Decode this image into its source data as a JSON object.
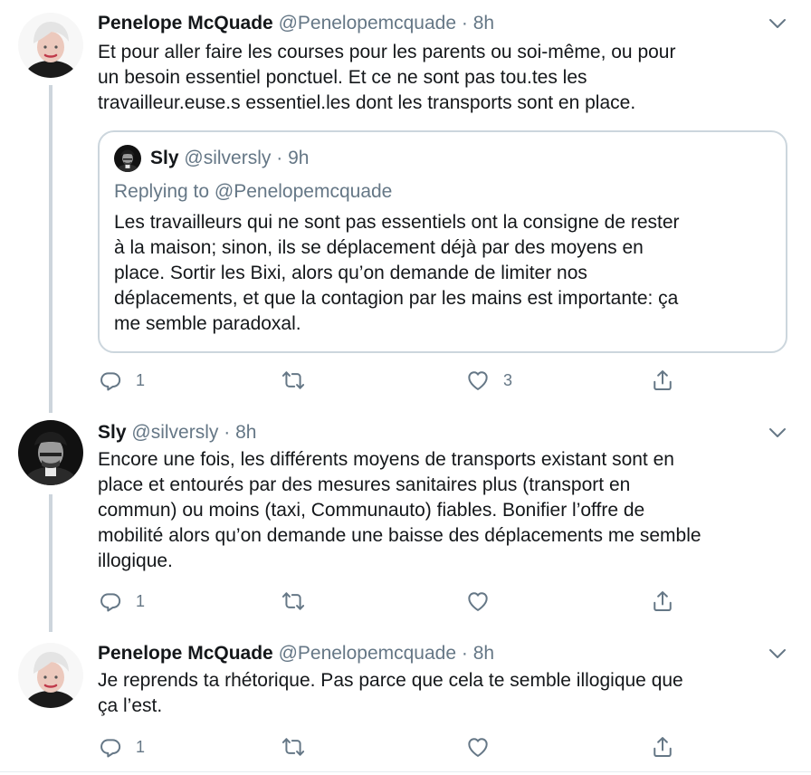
{
  "tweets": [
    {
      "name": "Penelope McQuade",
      "handle": "@Penelopemcquade",
      "dot": "·",
      "time": "8h",
      "lines": [
        "Et pour aller faire les courses pour les parents ou soi-même, ou pour",
        "un besoin essentiel ponctuel. Et ce ne sont pas tou.tes les",
        "travailleur.euse.s essentiel.les dont les transports sont en place."
      ],
      "quote": {
        "name": "Sly",
        "handle": "@silversly",
        "dot": "·",
        "time": "9h",
        "replying": "Replying to @Penelopemcquade",
        "lines": [
          "Les travailleurs qui ne sont pas essentiels ont la consigne de rester",
          "à la maison; sinon, ils se déplacement déjà par des moyens en",
          "place. Sortir les Bixi, alors qu’on demande de limiter nos",
          "déplacements, et que la contagion par les mains est importante: ça",
          "me semble paradoxal."
        ]
      },
      "reply_count": "1",
      "retweet_count": "",
      "like_count": "3"
    },
    {
      "name": "Sly",
      "handle": "@silversly",
      "dot": "·",
      "time": "8h",
      "lines": [
        "Encore une fois, les différents moyens de transports existant sont en",
        "place et entourés par des mesures sanitaires plus (transport en",
        "commun) ou moins (taxi, Communauto) fiables. Bonifier l’offre de",
        "mobilité alors qu’on demande une baisse des déplacements me semble",
        "illogique."
      ],
      "reply_count": "1",
      "retweet_count": "",
      "like_count": ""
    },
    {
      "name": "Penelope McQuade",
      "handle": "@Penelopemcquade",
      "dot": "·",
      "time": "8h",
      "lines": [
        "Je reprends ta rhétorique. Pas parce que cela te semble illogique que",
        "ça l’est."
      ],
      "reply_count": "1",
      "retweet_count": "",
      "like_count": ""
    }
  ],
  "icons": {
    "reply": "reply-icon",
    "retweet": "retweet-icon",
    "like": "heart-icon",
    "share": "share-icon",
    "caret": "chevron-down-icon"
  },
  "colors": {
    "text": "#14171a",
    "secondary": "#657786",
    "border": "#ccd6dd",
    "thread": "#cdd5dc"
  }
}
